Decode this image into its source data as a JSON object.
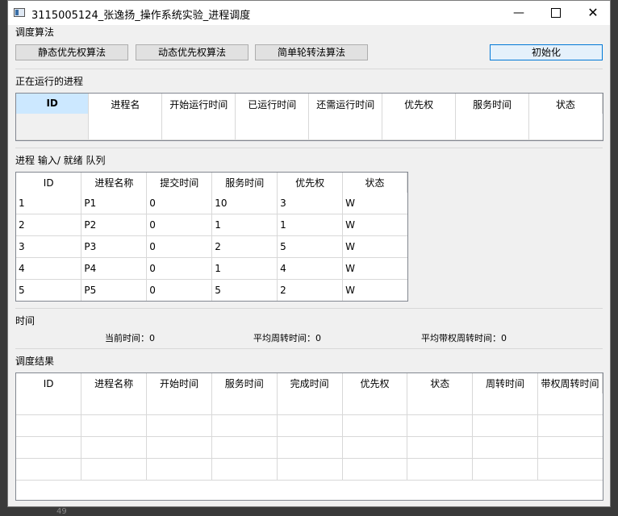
{
  "window": {
    "title": "3115005124_张逸扬_操作系统实验_进程调度",
    "minimize_glyph": "—",
    "close_glyph": "✕"
  },
  "sections": {
    "algorithm": "调度算法",
    "running": "正在运行的进程",
    "queue": "进程 输入/ 就绪 队列",
    "time": "时间",
    "result": "调度结果"
  },
  "buttons": {
    "static_priority": "静态优先权算法",
    "dynamic_priority": "动态优先权算法",
    "round_robin": "简单轮转法算法",
    "init": "初始化"
  },
  "running_table": {
    "headers": [
      "ID",
      "进程名",
      "开始运行时间",
      "已运行时间",
      "还需运行时间",
      "优先权",
      "服务时间",
      "状态"
    ],
    "rows": [
      [
        "",
        "",
        "",
        "",
        "",
        "",
        "",
        ""
      ]
    ]
  },
  "queue_table": {
    "headers": [
      "ID",
      "进程名称",
      "提交时间",
      "服务时间",
      "优先权",
      "状态"
    ],
    "rows": [
      [
        "1",
        "P1",
        "0",
        "10",
        "3",
        "W"
      ],
      [
        "2",
        "P2",
        "0",
        "1",
        "1",
        "W"
      ],
      [
        "3",
        "P3",
        "0",
        "2",
        "5",
        "W"
      ],
      [
        "4",
        "P4",
        "0",
        "1",
        "4",
        "W"
      ],
      [
        "5",
        "P5",
        "0",
        "5",
        "2",
        "W"
      ]
    ]
  },
  "time_info": {
    "current": "当前时间：0",
    "avg_turnaround": "平均周转时间：0",
    "avg_weighted_turnaround": "平均带权周转时间：0"
  },
  "result_table": {
    "headers": [
      "ID",
      "进程名称",
      "开始时间",
      "服务时间",
      "完成时间",
      "优先权",
      "状态",
      "周转时间",
      "带权周转时间"
    ],
    "rows": [
      [
        "",
        "",
        "",
        "",
        "",
        "",
        "",
        "",
        ""
      ],
      [
        "",
        "",
        "",
        "",
        "",
        "",
        "",
        "",
        ""
      ],
      [
        "",
        "",
        "",
        "",
        "",
        "",
        "",
        "",
        ""
      ],
      [
        "",
        "",
        "",
        "",
        "",
        "",
        "",
        "",
        ""
      ]
    ]
  },
  "background": {
    "line_number": "49"
  }
}
